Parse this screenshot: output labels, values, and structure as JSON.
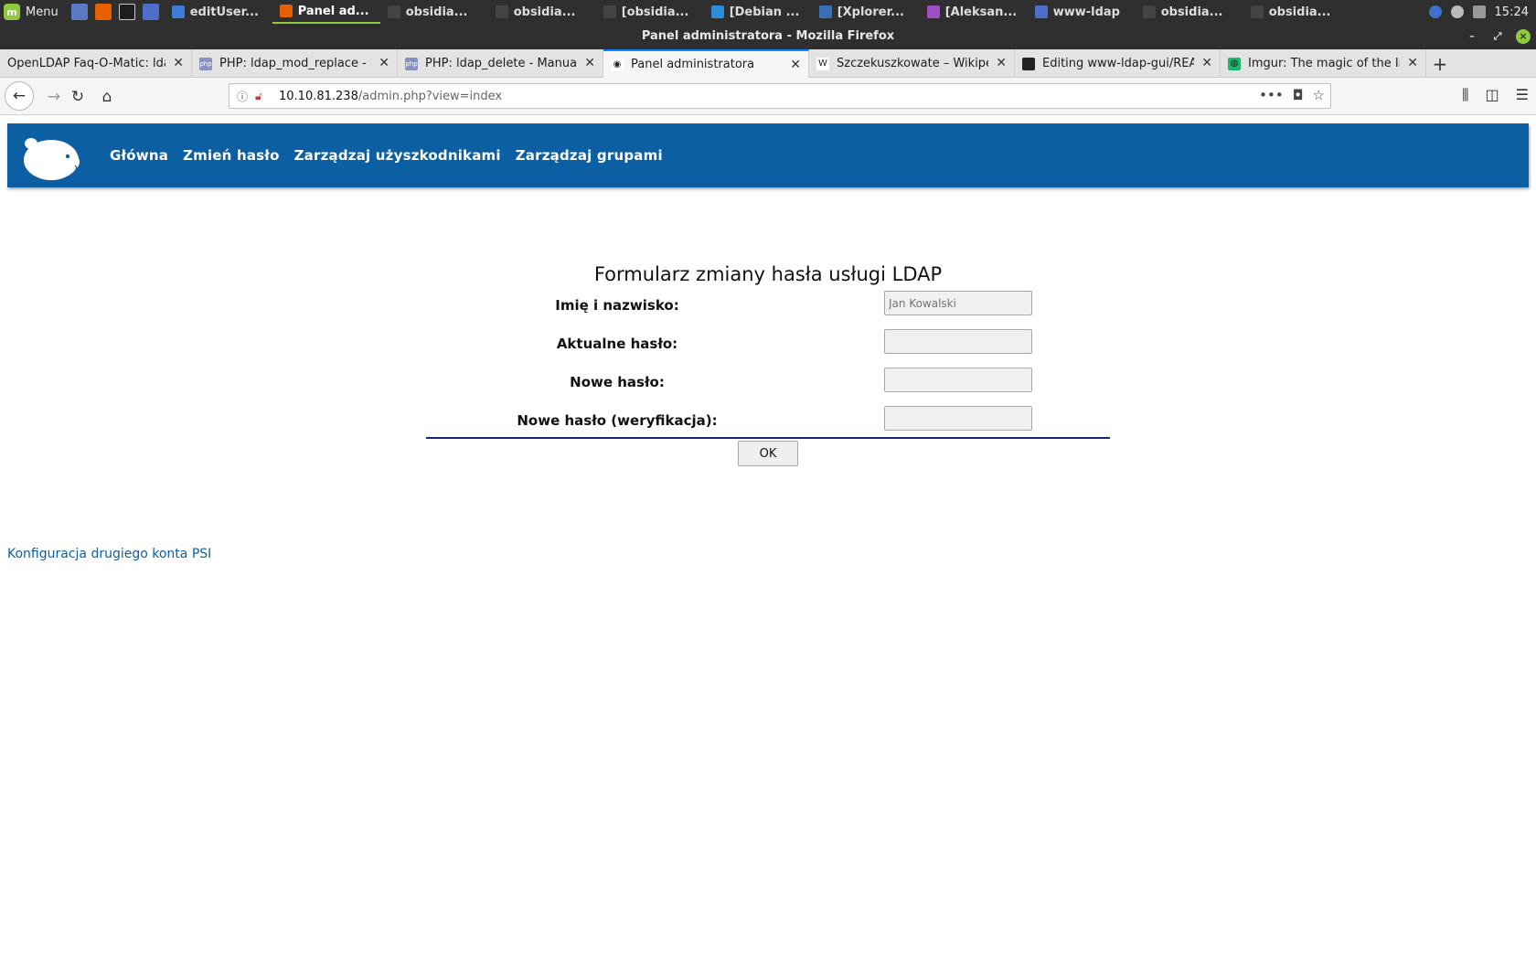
{
  "taskbar": {
    "menu_label": "Menu",
    "tasks": [
      {
        "label": "editUser...",
        "color": "#3e7bd6"
      },
      {
        "label": "Panel ad...",
        "color": "#e66000"
      },
      {
        "label": "obsidia...",
        "color": "#444444"
      },
      {
        "label": "obsidia...",
        "color": "#444444"
      },
      {
        "label": "[obsidia...",
        "color": "#444444"
      },
      {
        "label": "[Debian ...",
        "color": "#2e8bd8"
      },
      {
        "label": "[Xplorer...",
        "color": "#3a6fb5"
      },
      {
        "label": "[Aleksan...",
        "color": "#a04ec4"
      },
      {
        "label": "www-ldap",
        "color": "#4d6fc9"
      },
      {
        "label": "obsidia...",
        "color": "#444444"
      },
      {
        "label": "obsidia...",
        "color": "#444444"
      }
    ],
    "clock": "15:24"
  },
  "window": {
    "title": "Panel administratora - Mozilla Firefox"
  },
  "tabs": [
    {
      "label": "OpenLDAP Faq-O-Matic: ldap_add",
      "favicon": "",
      "active": false
    },
    {
      "label": "PHP: ldap_mod_replace - Manual",
      "favicon": "php",
      "active": false
    },
    {
      "label": "PHP: ldap_delete - Manual",
      "favicon": "php",
      "active": false
    },
    {
      "label": "Panel administratora",
      "favicon": "panda",
      "active": true
    },
    {
      "label": "Szczekuszkowate – Wikipedia",
      "favicon": "W",
      "active": false
    },
    {
      "label": "Editing www-ldap-gui/README",
      "favicon": "github",
      "active": false
    },
    {
      "label": "Imgur: The magic of the Internet",
      "favicon": "imgur",
      "active": false
    }
  ],
  "urlbar": {
    "host": "10.10.81.238",
    "path": "/admin.php?view=index"
  },
  "site": {
    "nav": [
      {
        "label": "Główna"
      },
      {
        "label": "Zmień hasło"
      },
      {
        "label": "Zarządzaj użyszkodnikami"
      },
      {
        "label": "Zarządzaj grupami"
      }
    ],
    "brand_color": "#0d5fa3"
  },
  "form": {
    "title": "Formularz zmiany hasła usługi LDAP",
    "fields": [
      {
        "label": "Imię i nazwisko:",
        "value": "",
        "placeholder": "Jan Kowalski"
      },
      {
        "label": "Aktualne hasło:",
        "value": "",
        "placeholder": ""
      },
      {
        "label": "Nowe hasło:",
        "value": "",
        "placeholder": ""
      },
      {
        "label": "Nowe hasło (weryfikacja):",
        "value": "",
        "placeholder": ""
      }
    ],
    "submit_label": "OK"
  },
  "footer": {
    "link": "Konfiguracja drugiego konta PSI"
  }
}
